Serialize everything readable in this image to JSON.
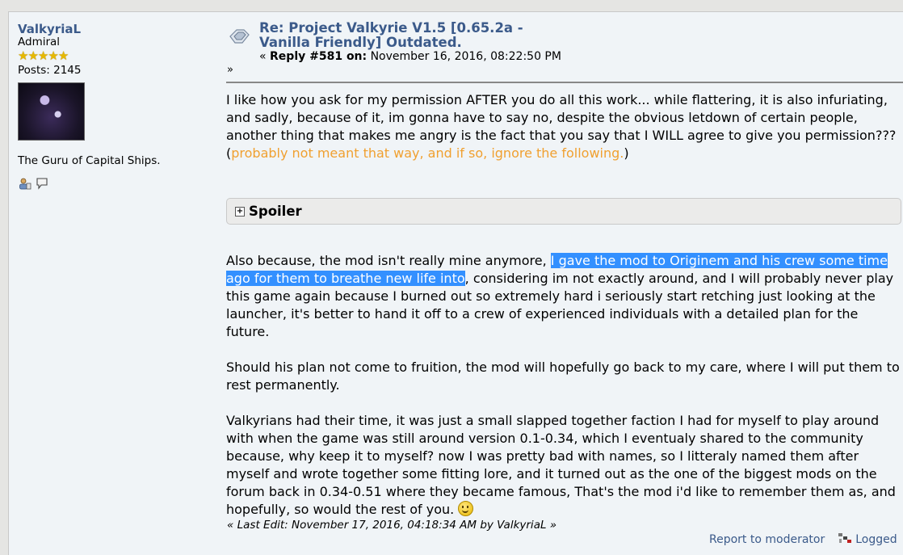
{
  "poster": {
    "name": "ValkyriaL",
    "rank": "Admiral",
    "stars": 5,
    "posts": "Posts: 2145",
    "custom_title": "The Guru of Capital Ships."
  },
  "post": {
    "subject": "Re: Project Valkyrie V1.5 [0.65.2a - Vanilla Friendly] Outdated.",
    "reply_prefix": "« ",
    "reply_label": "Reply #581 on:",
    "reply_date": " November 16, 2016, 08:22:50 PM",
    "raquo": "»",
    "para1_a": "I like how you ask for my permission AFTER you do all this work... while flattering, it is also infuriating, and sadly, because of it, im gonna have to say no, despite the obvious letdown of certain people,",
    "para1_b": "another thing that makes me angry is the fact that you say that I WILL agree to give you permission??? (",
    "para1_orange": "probably not meant that way, and if so, ignore the following.",
    "para1_end": ")",
    "spoiler_label": "Spoiler",
    "para2_a": "Also because, the mod isn't really mine anymore, ",
    "para2_sel": "I gave the mod to Originem and his crew some time ago for them to breathe new life into",
    "para2_b": ", considering im not exactly around, and I will probably never play this game again because I burned out so extremely hard i seriously start retching just looking at the launcher, it's better to hand it off to a crew of experienced individuals with a detailed plan for the future.",
    "para3": "Should his plan not come to fruition, the mod will hopefully go back to my care, where I will put them to rest permanently.",
    "para4": "Valkyrians had their time, it was just a small slapped together faction I had for myself to play around with when the game was still around version 0.1-0.34, which I eventualy shared to the community because, why keep it to myself? now I was pretty bad with names, so I litteraly named them after myself and wrote together some fitting lore, and it turned out as the one of the biggest mods on the forum back in 0.34-0.51 where they became famous, That's the mod i'd like to remember them as, and hopefully, so would the rest of you. ",
    "last_edit": "« Last Edit: November 17, 2016, 04:18:34 AM by ValkyriaL »",
    "report": "Report to moderator",
    "logged": "Logged"
  },
  "colors": {
    "link": "#3b5a8a",
    "highlight": "#3390ff",
    "orange_text": "#f0a030"
  }
}
